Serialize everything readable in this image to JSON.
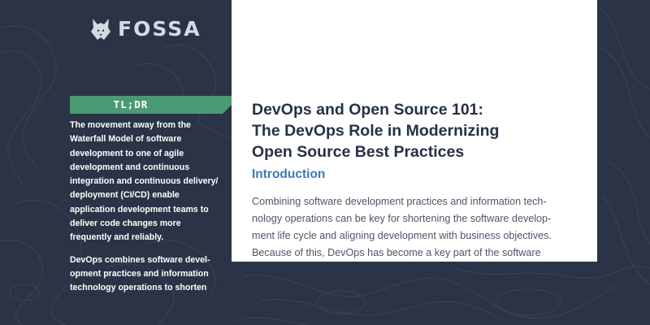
{
  "brand": {
    "logo_icon": "fox-head-icon",
    "name": "FOSSA"
  },
  "sidebar": {
    "tag": "TL;DR",
    "paragraphs": [
      "The movement away from the Waterfall Model of software development to one of agile development and continuous integration and continuous delivery/ deployment (CI/CD) enable application development teams to deliver code changes more frequently and reliably.",
      "DevOps combines software devel-opment practices and information technology operations to shorten"
    ]
  },
  "document": {
    "title": "DevOps and Open Source 101:\nThe DevOps Role in Modernizing\nOpen Source Best Practices",
    "section_heading": "Introduction",
    "body": "Combining software development practices and information tech-\nnology operations can be key for shortening the software develop-\nment life cycle and aligning development with business objectives.\nBecause of this, DevOps has become a key part of the software\ndevelopment team at any company. DevOps has become increas-\ningly important as software"
  },
  "colors": {
    "background": "#2b3446",
    "paper": "#ffffff",
    "tag_green": "#4a9a74",
    "title_navy": "#253146",
    "heading_blue": "#3a7bb8",
    "body_gray": "#4d5566"
  }
}
